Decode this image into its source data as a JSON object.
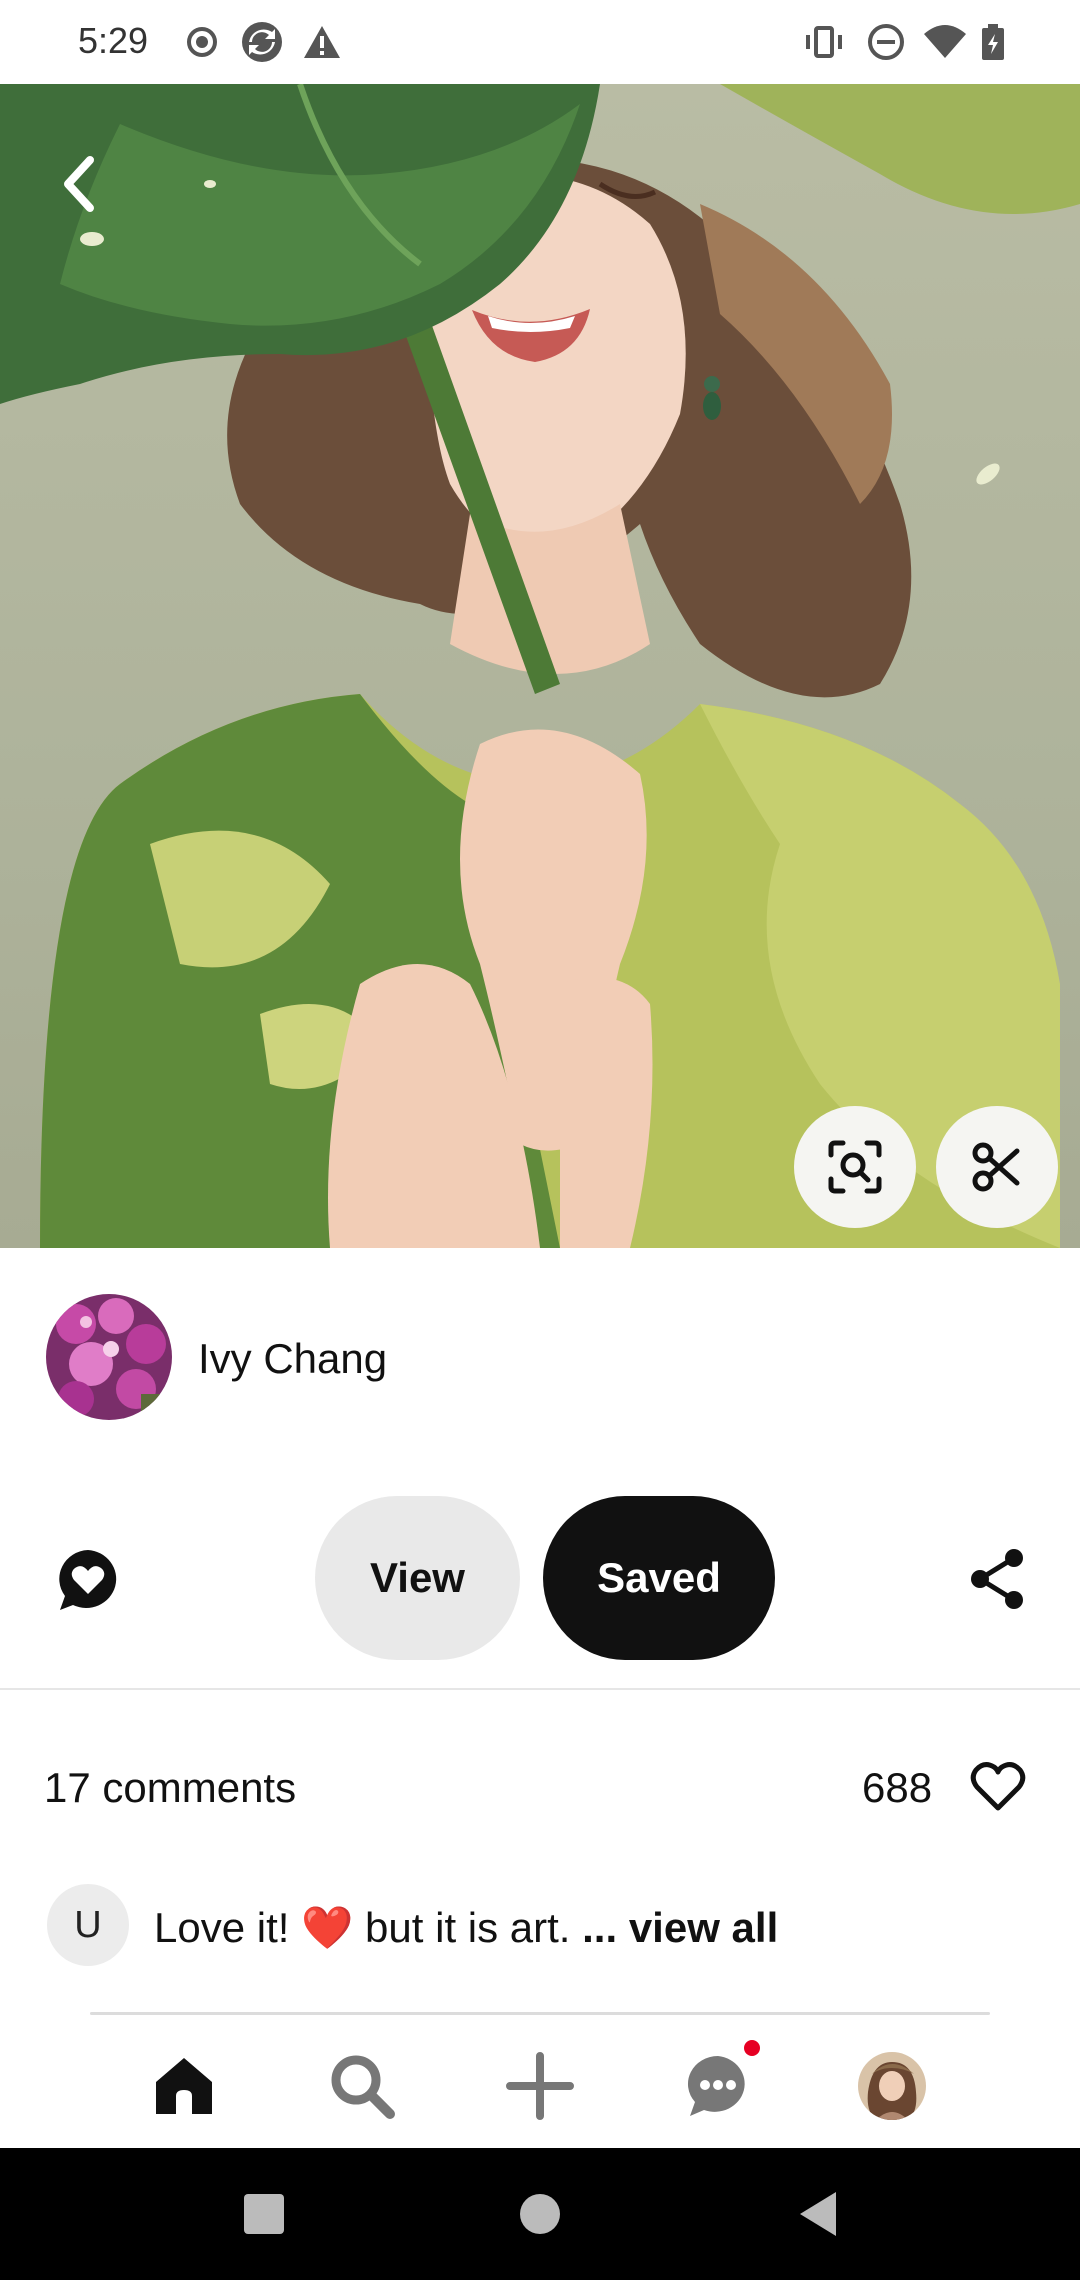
{
  "status_bar": {
    "time": "5:29",
    "left_icons": [
      "record-icon",
      "sync-icon",
      "warning-icon"
    ],
    "right_icons": [
      "vibrate-icon",
      "do-not-disturb-icon",
      "wifi-icon",
      "battery-icon"
    ]
  },
  "pin": {
    "image_description_icon": "illustration-woman-under-lotus-leaf",
    "lens_button_icon": "visual-search-icon",
    "cutout_button_icon": "scissors-icon"
  },
  "author": {
    "name": "Ivy Chang"
  },
  "actions": {
    "view_label": "View",
    "saved_label": "Saved"
  },
  "stats": {
    "comments_label": "17 comments",
    "likes_count": "688"
  },
  "comment_preview": {
    "avatar_initial": "U",
    "text_before": "Love it! ",
    "emoji": "❤️",
    "text_after": " but it is art. ",
    "view_all": "... view all"
  },
  "bottom_nav": {
    "items": [
      "home-icon",
      "search-icon",
      "create-icon",
      "messages-icon",
      "profile-avatar"
    ],
    "messages_has_notification": true
  },
  "colors": {
    "accent_red": "#e60023",
    "saved_bg": "#111111",
    "view_bg": "#e9e9e9"
  }
}
